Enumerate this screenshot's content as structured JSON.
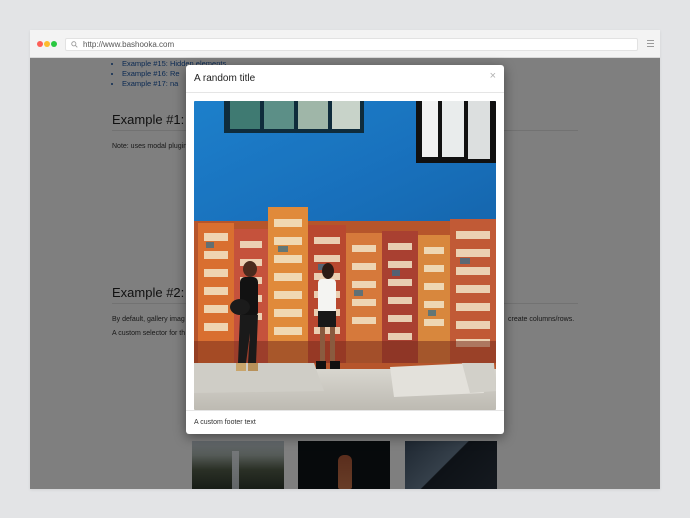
{
  "browser": {
    "url": "http://www.bashooka.com"
  },
  "page": {
    "list_items": [
      "Example #15: Hidden elements",
      "Example #16: Re",
      "Example #17: na"
    ],
    "example1_heading": "Example #1: S",
    "example1_note": "Note: uses modal plugin",
    "example2_heading": "Example #2: G",
    "example2_text": "By default, gallery imag",
    "example2_text_right": "create columns/rows.",
    "example2_text2": "A custom selector for th"
  },
  "modal": {
    "title": "A random title",
    "close_symbol": "×",
    "footer_text": "A custom footer text"
  },
  "colors": {
    "wall_blue": "#1e7bc8",
    "overlay": "rgba(0,0,0,0.5)"
  }
}
